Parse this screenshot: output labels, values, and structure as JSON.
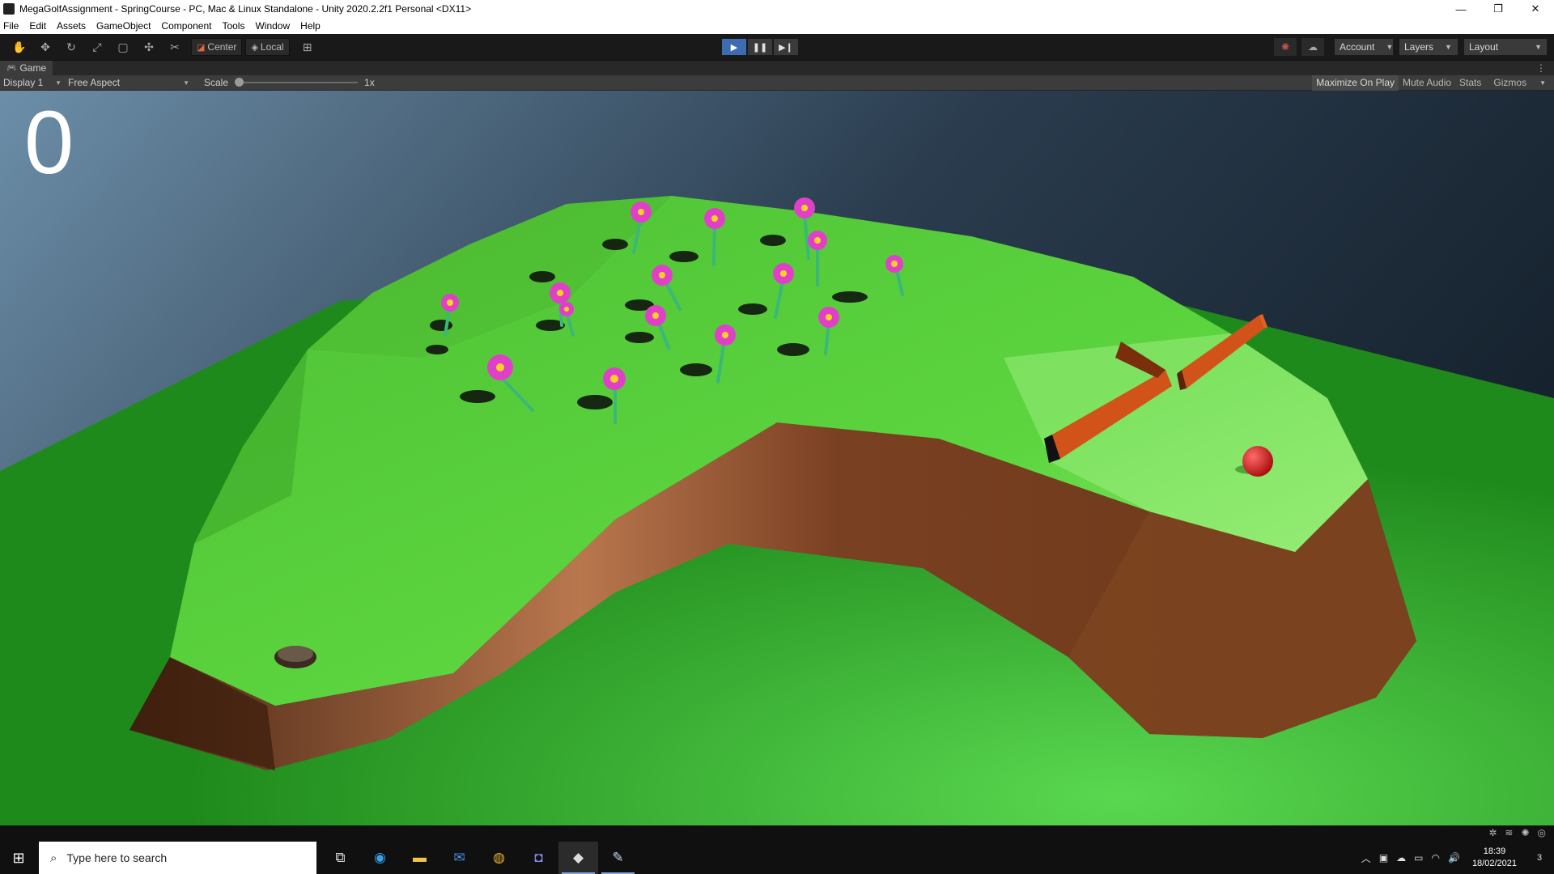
{
  "window": {
    "title": "MegaGolfAssignment - SpringCourse - PC, Mac & Linux Standalone - Unity 2020.2.2f1 Personal <DX11>",
    "controls": [
      "—",
      "❐",
      "✕"
    ]
  },
  "menu": [
    "File",
    "Edit",
    "Assets",
    "GameObject",
    "Component",
    "Tools",
    "Window",
    "Help"
  ],
  "toolbar": {
    "pivot_label": "Center",
    "space_label": "Local",
    "account_label": "Account",
    "layers_label": "Layers",
    "layout_label": "Layout"
  },
  "tab": {
    "label": "Game"
  },
  "game_controls": {
    "display": "Display 1",
    "aspect": "Free Aspect",
    "scale_label": "Scale",
    "scale_value": "1x",
    "maximize": "Maximize On Play",
    "mute": "Mute Audio",
    "stats": "Stats",
    "gizmos": "Gizmos"
  },
  "game": {
    "score": "0"
  },
  "taskbar": {
    "search_placeholder": "Type here to search",
    "time": "18:39",
    "date": "18/02/2021",
    "notification_count": "3"
  },
  "colors": {
    "grass": "#5ad23c",
    "grass_bright": "#8cf06a",
    "dirt": "#8a4e2a",
    "wall": "#c24a14",
    "ball": "#d62020",
    "flower": "#e040c8"
  }
}
